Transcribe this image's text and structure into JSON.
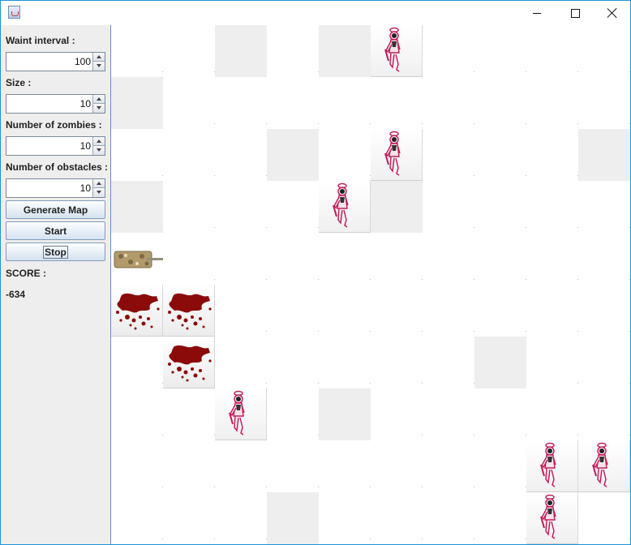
{
  "window": {
    "controls": {
      "minimize": "minimize-icon",
      "maximize": "maximize-icon",
      "close": "close-icon"
    }
  },
  "sidebar": {
    "wait_label": "Waint interval :",
    "wait_value": "100",
    "size_label": "Size :",
    "size_value": "10",
    "zombies_label": "Number of zombies :",
    "zombies_value": "10",
    "obstacles_label": "Number of obstacles :",
    "obstacles_value": "10",
    "generate_label": "Generate Map",
    "start_label": "Start",
    "stop_label": "Stop",
    "score_label": "SCORE :",
    "score_value": "-634"
  },
  "map": {
    "size": 10,
    "legend": {
      "O": "obstacle",
      "Z": "zombie",
      "B": "blood",
      "T": "tank",
      ".": "empty"
    },
    "rows": [
      "..O.OZ....",
      "O.........",
      "...O.Z...O",
      "O...ZO....",
      "T.........",
      "BB........",
      ".B.....O..",
      "..Z.O.....",
      "........ZZ",
      "...O....Z."
    ],
    "colors": {
      "obstacle": "#eeeeee",
      "blood": "#8b0a0a",
      "zombie_outline": "#c2185b",
      "tank": "#b29a6a"
    }
  }
}
